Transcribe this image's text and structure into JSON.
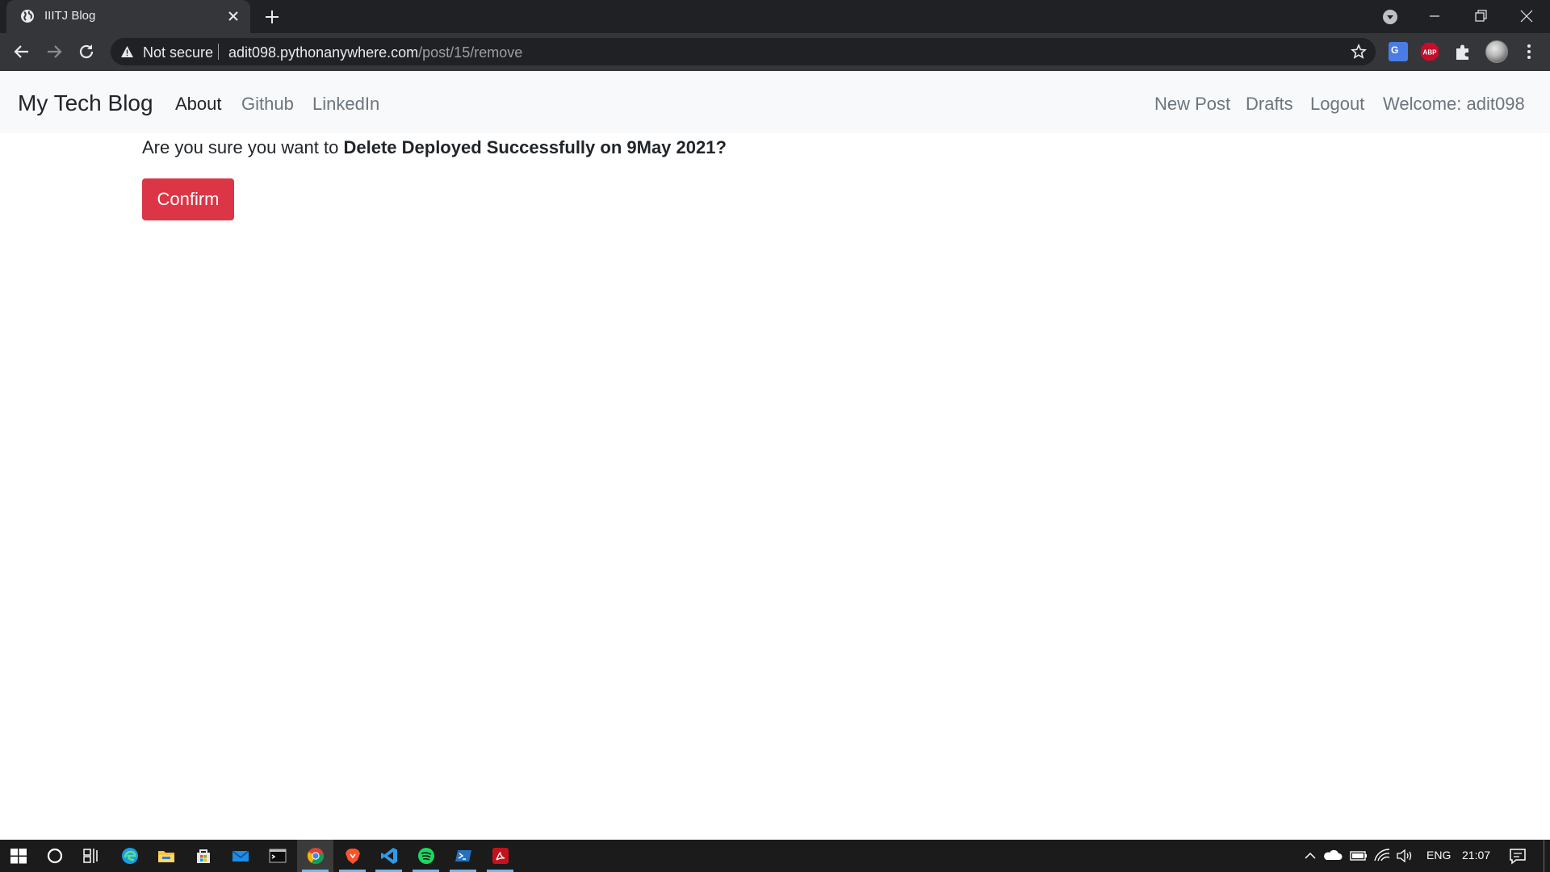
{
  "browser": {
    "tab_title": "IIITJ Blog",
    "security_label": "Not secure",
    "url_host": "adit098.pythonanywhere.com",
    "url_path": "/post/15/remove",
    "extensions": {
      "abp_label": "ABP",
      "translate_label": "G"
    }
  },
  "site": {
    "brand": "My Tech Blog",
    "nav_left": [
      "About",
      "Github",
      "LinkedIn"
    ],
    "nav_right": [
      "New Post",
      "Drafts",
      "Logout",
      "Welcome: adit098"
    ]
  },
  "content": {
    "question_prefix": "Are you sure you want to",
    "question_target": "Delete Deployed Successfully on 9May 2021?",
    "confirm_label": "Confirm"
  },
  "taskbar": {
    "language": "ENG",
    "time": "21:07",
    "apps": [
      "start-icon",
      "search-icon",
      "task-view-icon",
      "edge-icon",
      "file-explorer-icon",
      "store-icon",
      "mail-icon",
      "terminal-icon",
      "chrome-icon",
      "brave-icon",
      "vscode-icon",
      "spotify-icon",
      "powershell-icon",
      "acrobat-icon"
    ]
  },
  "colors": {
    "danger": "#dc3545",
    "navbar_bg": "#f8f9fa",
    "chrome_dark": "#35363a"
  }
}
